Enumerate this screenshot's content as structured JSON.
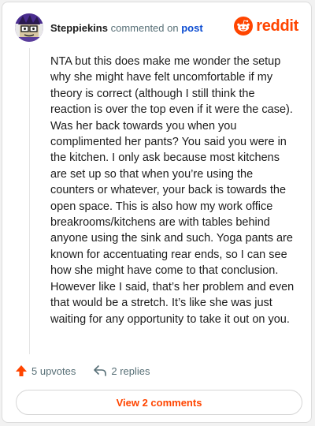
{
  "comment": {
    "username": "Steppiekins",
    "action_text": "commented on",
    "target_link": "post",
    "body": "NTA but this does make me wonder the setup why she might have felt uncomfortable if my theory is correct (although I still think the reaction is over the top even if it were the case). Was her back towards you when you complimented her pants? You said you were in the kitchen. I only ask because most kitchens are set up so that when you’re using the counters or whatever, your back is towards the open space. This is also how my work office breakrooms/kitchens are with tables behind anyone using the sink and such. Yoga pants are known for accentuating rear ends, so I can see how she might have come to that conclusion. However like I said, that’s her problem and even that would be a stretch. It’s like she was just waiting for any opportunity to take it out on you.",
    "upvotes": "5 upvotes",
    "replies": "2 replies"
  },
  "brand": {
    "name": "reddit",
    "color": "#ff4500"
  },
  "footer": {
    "view_comments_label": "View 2 comments"
  },
  "icons": {
    "avatar": "avatar",
    "logo": "reddit-snoo-icon",
    "upvote": "upvote-arrow-icon",
    "reply": "reply-arrow-icon"
  }
}
